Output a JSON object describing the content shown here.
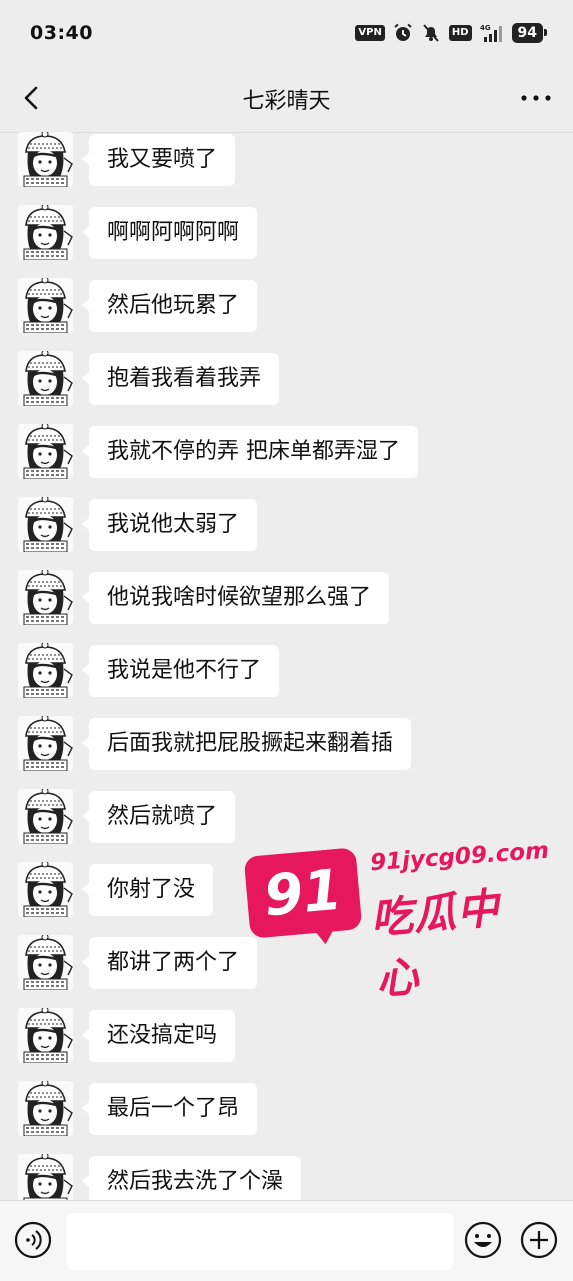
{
  "status": {
    "time": "03:40",
    "vpn": "VPN",
    "hd": "HD",
    "network": "4G",
    "battery": "94"
  },
  "header": {
    "title": "七彩晴天"
  },
  "messages": [
    {
      "text": "我又要喷了"
    },
    {
      "text": "啊啊阿啊阿啊"
    },
    {
      "text": "然后他玩累了"
    },
    {
      "text": "抱着我看着我弄"
    },
    {
      "text": "我就不停的弄 把床单都弄湿了"
    },
    {
      "text": "我说他太弱了"
    },
    {
      "text": "他说我啥时候欲望那么强了"
    },
    {
      "text": "我说是他不行了"
    },
    {
      "text": "后面我就把屁股撅起来翻着插"
    },
    {
      "text": "然后就喷了"
    },
    {
      "text": "你射了没"
    },
    {
      "text": "都讲了两个了"
    },
    {
      "text": "还没搞定吗"
    },
    {
      "text": "最后一个了昂"
    },
    {
      "text": "然后我去洗了个澡"
    }
  ],
  "watermark": {
    "logo_number": "91",
    "url": "91jycg09.com",
    "name": "吃瓜中心",
    "color": "#e6175c"
  },
  "input": {
    "value": ""
  },
  "icons": {
    "back": "back-arrow-icon",
    "more": "more-dots-icon",
    "voice": "voice-icon",
    "emoji": "emoji-icon",
    "plus": "plus-icon"
  }
}
